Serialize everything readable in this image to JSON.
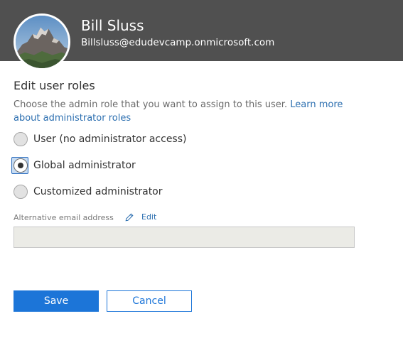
{
  "header": {
    "name": "Bill Sluss",
    "email": "Billsluss@edudevcamp.onmicrosoft.com"
  },
  "panel": {
    "title": "Edit user roles",
    "description": "Choose the admin role that you want to assign to this user.",
    "learn_more_link": "Learn more about administrator roles"
  },
  "roles": {
    "options": [
      {
        "label": "User (no administrator access)",
        "checked": false
      },
      {
        "label": "Global administrator",
        "checked": true
      },
      {
        "label": "Customized administrator",
        "checked": false
      }
    ]
  },
  "alt_email": {
    "label": "Alternative email address",
    "edit_label": "Edit",
    "value": ""
  },
  "buttons": {
    "save_label": "Save",
    "cancel_label": "Cancel"
  },
  "colors": {
    "header_bg": "#505050",
    "accent": "#1c75d8",
    "link": "#2c6fb0"
  },
  "icons": {
    "edit": "pencil-icon"
  }
}
